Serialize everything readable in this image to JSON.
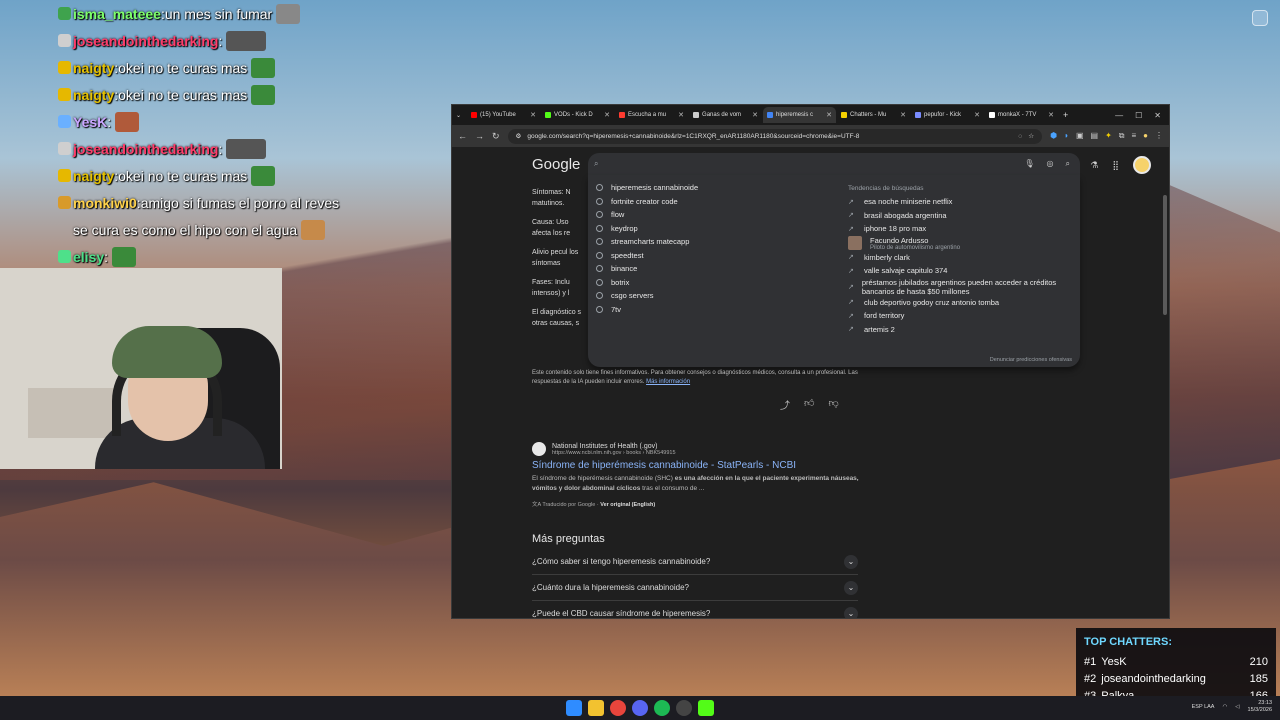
{
  "chat": [
    {
      "user": "isma_mateee",
      "color": "#7dff6b",
      "message": "un mes sin fumar"
    },
    {
      "user": "joseandointhedarking",
      "color": "#ff3d6b",
      "message": ""
    },
    {
      "user": "naigty",
      "color": "#e6c200",
      "message": "okei no te curas mas"
    },
    {
      "user": "naigty",
      "color": "#e6c200",
      "message": "okei no te curas mas"
    },
    {
      "user": "YesK",
      "color": "#c9a6ff",
      "message": ""
    },
    {
      "user": "joseandointhedarking",
      "color": "#ff3d6b",
      "message": ""
    },
    {
      "user": "naigty",
      "color": "#e6c200",
      "message": "okei no te curas mas"
    },
    {
      "user": "monkiwi0",
      "color": "#ffd24a",
      "message": "amigo si fumas el porro al reves"
    },
    {
      "user": "",
      "color": "#ffffff",
      "message": "se cura es como el hipo con el agua"
    },
    {
      "user": "elisy",
      "color": "#4ee08a",
      "message": ""
    }
  ],
  "browser": {
    "tabs": [
      {
        "label": "(15) YouTube",
        "color": "#ff0000"
      },
      {
        "label": "VODs - Kick D",
        "color": "#53fc18"
      },
      {
        "label": "Escucha a mu",
        "color": "#ff3b30"
      },
      {
        "label": "Ganas de vom",
        "color": "#cccccc"
      },
      {
        "label": "hiperemesis c",
        "color": "#4285f4",
        "active": true
      },
      {
        "label": "Chatters - Mu",
        "color": "#f5d000"
      },
      {
        "label": "pepufor - Kick",
        "color": "#7a8cff"
      },
      {
        "label": "monkaX - 7TV",
        "color": "#ffffff"
      }
    ],
    "url": "google.com/search?q=hiperemesis+cannabinoide&rlz=1C1RXQR_enAR1180AR1180&sourceid=chrome&ie=UTF-8",
    "google": {
      "logo": "Google",
      "suggestions": [
        "hiperemesis cannabinoide",
        "fortnite creator code",
        "flow",
        "keydrop",
        "streamcharts matecapp",
        "speedtest",
        "binance",
        "botrix",
        "csgo servers",
        "7tv"
      ],
      "trends_title": "Tendencias de búsquedas",
      "trends": [
        {
          "text": "esa noche miniserie netflix"
        },
        {
          "text": "brasil abogada argentina"
        },
        {
          "text": "iphone 18 pro max"
        },
        {
          "text": "Facundo Ardusso",
          "sub": "Piloto de automovilismo argentino",
          "photo": true
        },
        {
          "text": "kimberly clark"
        },
        {
          "text": "valle salvaje capitulo 374"
        },
        {
          "text": "préstamos jubilados argentinos pueden acceder a créditos bancarios de hasta $50 millones"
        },
        {
          "text": "club deportivo godoy cruz antonio tomba"
        },
        {
          "text": "ford territory"
        },
        {
          "text": "artemis 2"
        }
      ],
      "report": "Denunciar predicciones ofensivas",
      "bullets": [
        "Síntomas: N matutinos.",
        "Causa: Uso afecta los re",
        "Alivio pecul los síntomas",
        "Fases: Inclu intensos) y l",
        "El diagnóstico s otras causas, s"
      ],
      "disclaimer": "Este contenido solo tiene fines informativos. Para obtener consejos o diagnósticos médicos, consulta a un profesional. Las respuestas de la IA pueden incluir errores.",
      "disclaimer_link": "Más información",
      "result": {
        "site": "National Institutes of Health (.gov)",
        "url": "https://www.ncbi.nlm.nih.gov › books › NBK549915",
        "title": "Síndrome de hiperémesis cannabinoide - StatPearls - NCBI",
        "snippet_a": "El síndrome de hiperémesis cannabinoide (SHC)",
        "snippet_b": "es una afección en la que el paciente experimenta náuseas, vómitos y dolor abdominal cíclicos",
        "snippet_c": "tras el consumo de ...",
        "translated": "Traducido por Google",
        "original": "Ver original (English)"
      },
      "paa_title": "Más preguntas",
      "paa": [
        "¿Cómo saber si tengo hiperemesis cannabinoide?",
        "¿Cuánto dura la hiperemesis cannabinoide?",
        "¿Puede el CBD causar síndrome de hiperemesis?"
      ]
    }
  },
  "top_chatters": {
    "title": "TOP CHATTERS:",
    "rows": [
      {
        "rank": "#1",
        "name": "YesK",
        "count": "210"
      },
      {
        "rank": "#2",
        "name": "joseandointhedarking",
        "count": "185"
      },
      {
        "rank": "#3",
        "name": "Palkya",
        "count": "166"
      }
    ]
  },
  "taskbar": {
    "lang": "ESP LAA",
    "time": "23:13",
    "date": "15/3/2026"
  }
}
